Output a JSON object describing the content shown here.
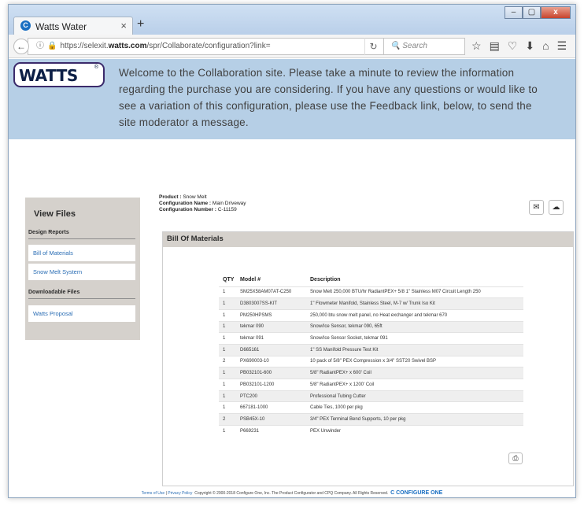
{
  "browser": {
    "tab_title": "Watts Water",
    "tab_close": "×",
    "new_tab": "+",
    "url_prefix": "https://selexit.",
    "url_host": "watts.com",
    "url_path": "/spr/Collaborate/configuration?link=",
    "search_placeholder": "Search",
    "window_buttons": [
      "–",
      "▢",
      "x"
    ]
  },
  "banner": {
    "logo_text": "WATTS",
    "logo_reg": "®",
    "welcome": "Welcome to the Collaboration site. Please take a minute to review the information regarding the purchase you are considering. If you have any questions or would like to see a variation of this configuration, please use the Feedback link, below, to send the site moderator a message."
  },
  "sidebar": {
    "title": "View Files",
    "design_reports_label": "Design Reports",
    "design_reports": [
      "Bill of Materials",
      "Snow Melt System"
    ],
    "downloadable_label": "Downloadable Files",
    "downloadable": [
      "Watts Proposal"
    ]
  },
  "product": {
    "product_label": "Product :",
    "product_value": "Snow Melt",
    "config_name_label": "Configuration Name :",
    "config_name_value": "Main Driveway",
    "config_number_label": "Configuration Number :",
    "config_number_value": "C-11159"
  },
  "bom": {
    "title": "Bill Of Materials",
    "headers": {
      "qty": "QTY",
      "model": "Model #",
      "desc": "Description"
    },
    "rows": [
      {
        "qty": "1",
        "model": "SM25X58AM07AT-C250",
        "desc": "Snow Melt 250,000 BTU/hr RadiantPEX+ 5/8 1\" Stainless M07 Circuit Length 250"
      },
      {
        "qty": "1",
        "model": "D3803007SS-KIT",
        "desc": "1\" Flowmeter Manifold, Stainless Steel, M-7 w/ Trunk Iso Kit"
      },
      {
        "qty": "1",
        "model": "PM250HPSMS",
        "desc": "250,000 btu snow melt panel, no Heat exchanger and tekmar 670"
      },
      {
        "qty": "1",
        "model": "tekmar 090",
        "desc": "Snow/Ice Sensor, tekmar 090, 65ft"
      },
      {
        "qty": "1",
        "model": "tekmar 091",
        "desc": "Snow/Ice Sensor Socket, tekmar 091"
      },
      {
        "qty": "1",
        "model": "D665161",
        "desc": "1\" SS Manifold Pressure Test Kit"
      },
      {
        "qty": "2",
        "model": "PX690003-10",
        "desc": "10 pack of 5/8\" PEX Compression x 3/4\" SST20 Swivel BSP"
      },
      {
        "qty": "1",
        "model": "PB032101-600",
        "desc": "5/8\" RadiantPEX+ x 600' Coil"
      },
      {
        "qty": "1",
        "model": "PB032101-1200",
        "desc": "5/8\" RadiantPEX+ x 1200' Coil"
      },
      {
        "qty": "1",
        "model": "PTC200",
        "desc": "Professional Tubing Cutter"
      },
      {
        "qty": "1",
        "model": "667181-1000",
        "desc": "Cable Ties, 1000 per pkg"
      },
      {
        "qty": "2",
        "model": "PSB45X-10",
        "desc": "3/4\" PEX Terminal Bend Supports, 10 per pkg"
      },
      {
        "qty": "1",
        "model": "P669231",
        "desc": "PEX Unwinder"
      }
    ]
  },
  "footer": {
    "terms": "Terms of Use",
    "sep": "|",
    "privacy": "Privacy Policy",
    "copyright": "Copyright © 2000-2018 Configure One, Inc. The Product Configurator and CPQ Company. All Rights Reserved.",
    "brand": "CONFIGURE ONE"
  }
}
